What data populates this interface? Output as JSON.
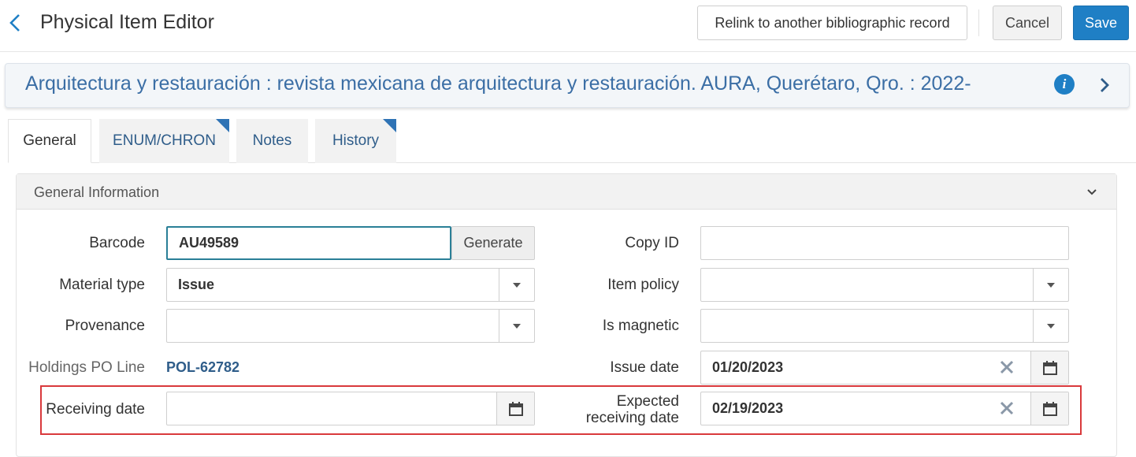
{
  "header": {
    "title": "Physical Item Editor",
    "relink_label": "Relink to another bibliographic record",
    "cancel_label": "Cancel",
    "save_label": "Save"
  },
  "record": {
    "title": "Arquitectura y restauración : revista mexicana de arquitectura y restauración. AURA, Querétaro, Qro. : 2022-",
    "info_glyph": "i"
  },
  "tabs": [
    {
      "label": "General",
      "active": true
    },
    {
      "label": "ENUM/CHRON",
      "active": false
    },
    {
      "label": "Notes",
      "active": false
    },
    {
      "label": "History",
      "active": false
    }
  ],
  "panel": {
    "title": "General Information"
  },
  "form": {
    "barcode": {
      "label": "Barcode",
      "value": "AU49589"
    },
    "generate_label": "Generate",
    "material_type": {
      "label": "Material type",
      "value": "Issue"
    },
    "provenance": {
      "label": "Provenance",
      "value": ""
    },
    "holdings_po_line": {
      "label": "Holdings PO Line",
      "value": "POL-62782"
    },
    "receiving_date": {
      "label": "Receiving date",
      "value": ""
    },
    "copy_id": {
      "label": "Copy ID",
      "value": ""
    },
    "item_policy": {
      "label": "Item policy",
      "value": ""
    },
    "is_magnetic": {
      "label": "Is magnetic",
      "value": ""
    },
    "issue_date": {
      "label": "Issue date",
      "value": "01/20/2023"
    },
    "expected_receiving_date": {
      "label_line1": "Expected",
      "label_line2": "receiving date",
      "value": "02/19/2023"
    }
  },
  "colors": {
    "accent": "#1f7fc5",
    "link": "#2f5d8a",
    "highlight": "#d9393c"
  }
}
